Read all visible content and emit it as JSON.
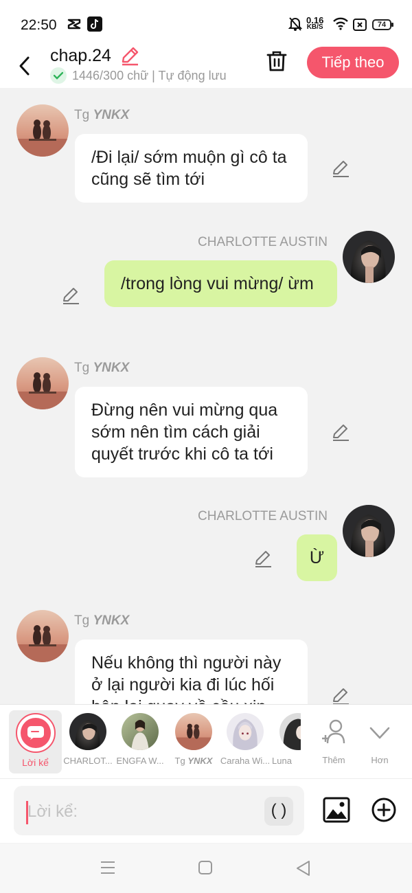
{
  "status_bar": {
    "time": "22:50",
    "net_speed_value": "0.16",
    "net_speed_unit": "KB/S",
    "battery": "74"
  },
  "header": {
    "title": "chap.24",
    "save_status": "1446/300 chữ | Tự động lưu",
    "next_label": "Tiếp theo"
  },
  "messages": [
    {
      "side": "left",
      "sender_prefix": "Tg",
      "sender_name": "YNKX",
      "text": "/Đi lại/ sớm muộn gì cô ta cũng sẽ tìm tới"
    },
    {
      "side": "right",
      "sender_name": "CHARLOTTE AUSTIN",
      "text": "/trong lòng vui mừng/ ừm"
    },
    {
      "side": "left",
      "sender_prefix": "Tg",
      "sender_name": "YNKX",
      "text": "Đừng nên vui mừng qua sớm nên tìm cách giải quyết trước khi cô ta tới"
    },
    {
      "side": "right",
      "sender_name": "CHARLOTTE AUSTIN",
      "text": "Ừ"
    },
    {
      "side": "left",
      "sender_prefix": "Tg",
      "sender_name": "YNKX",
      "text": "Nếu không thì người này ở lại người kia đi lúc hối hận lại quay về cầu xin"
    }
  ],
  "characters": {
    "narrator_label": "Lời kể",
    "items": [
      {
        "name": "CHARLOT...",
        "avatar": "dark-hair-woman"
      },
      {
        "name": "ENGFA W...",
        "avatar": "sitting-woman"
      },
      {
        "name_prefix": "Tg",
        "name": "YNKX",
        "avatar": "couple-beach"
      },
      {
        "name": "Caraha Wi...",
        "avatar": "anime-girl"
      },
      {
        "name": "Luna",
        "avatar": "dark-figure"
      }
    ],
    "add_label": "Thêm",
    "more_label": "Hơn"
  },
  "input": {
    "placeholder": "Lời kể:",
    "paren_label": "( )"
  },
  "colors": {
    "accent": "#f5566c",
    "right_bubble": "#d8f5a2",
    "left_bubble": "#ffffff",
    "background": "#f2f2f2"
  }
}
